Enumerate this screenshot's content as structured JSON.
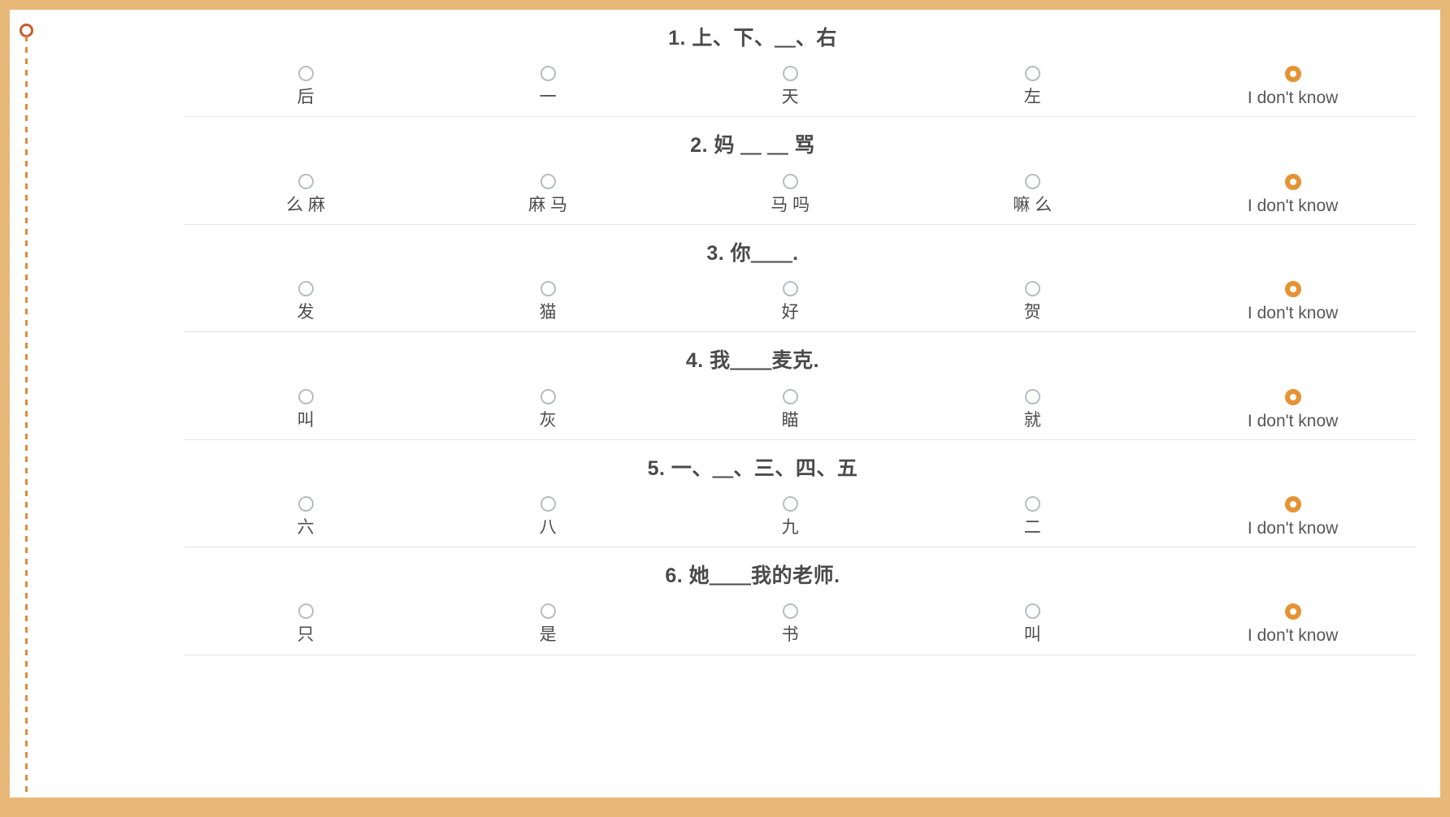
{
  "theme": {
    "frame_color": "#e8b878",
    "accent_color": "#e69334",
    "rail_dash_color": "#e08a3c",
    "rail_node_color": "#c75b28",
    "text_color": "#4a4a4a",
    "radio_border_color": "#b9bcc0",
    "separator_color": "#e3e4e6"
  },
  "rail": {
    "node_icon": "circle-node-icon",
    "line_icon": "dashed-line-icon"
  },
  "quiz": {
    "questions": [
      {
        "number": "1.",
        "title": "1. 上、下、＿、右",
        "options": [
          {
            "label": "后",
            "selected": false,
            "kind": "cjk"
          },
          {
            "label": "一",
            "selected": false,
            "kind": "cjk"
          },
          {
            "label": "天",
            "selected": false,
            "kind": "cjk"
          },
          {
            "label": "左",
            "selected": false,
            "kind": "cjk"
          },
          {
            "label": "I don't know",
            "selected": true,
            "kind": "latin"
          }
        ]
      },
      {
        "number": "2.",
        "title": "2. 妈 ＿ ＿ 骂",
        "options": [
          {
            "label": "么 麻",
            "selected": false,
            "kind": "cjk"
          },
          {
            "label": "麻 马",
            "selected": false,
            "kind": "cjk"
          },
          {
            "label": "马 吗",
            "selected": false,
            "kind": "cjk"
          },
          {
            "label": "嘛 么",
            "selected": false,
            "kind": "cjk"
          },
          {
            "label": "I don't know",
            "selected": true,
            "kind": "latin"
          }
        ]
      },
      {
        "number": "3.",
        "title": "3. 你＿＿.",
        "options": [
          {
            "label": "发",
            "selected": false,
            "kind": "cjk"
          },
          {
            "label": "猫",
            "selected": false,
            "kind": "cjk"
          },
          {
            "label": "好",
            "selected": false,
            "kind": "cjk"
          },
          {
            "label": "贺",
            "selected": false,
            "kind": "cjk"
          },
          {
            "label": "I don't know",
            "selected": true,
            "kind": "latin"
          }
        ]
      },
      {
        "number": "4.",
        "title": "4. 我＿＿麦克.",
        "options": [
          {
            "label": "叫",
            "selected": false,
            "kind": "cjk"
          },
          {
            "label": "灰",
            "selected": false,
            "kind": "cjk"
          },
          {
            "label": "瞄",
            "selected": false,
            "kind": "cjk"
          },
          {
            "label": "就",
            "selected": false,
            "kind": "cjk"
          },
          {
            "label": "I don't know",
            "selected": true,
            "kind": "latin"
          }
        ]
      },
      {
        "number": "5.",
        "title": "5. 一、＿、三、四、五",
        "options": [
          {
            "label": "六",
            "selected": false,
            "kind": "cjk"
          },
          {
            "label": "八",
            "selected": false,
            "kind": "cjk"
          },
          {
            "label": "九",
            "selected": false,
            "kind": "cjk"
          },
          {
            "label": "二",
            "selected": false,
            "kind": "cjk"
          },
          {
            "label": "I don't know",
            "selected": true,
            "kind": "latin"
          }
        ]
      },
      {
        "number": "6.",
        "title": "6. 她＿＿我的老师.",
        "options": [
          {
            "label": "只",
            "selected": false,
            "kind": "cjk"
          },
          {
            "label": "是",
            "selected": false,
            "kind": "cjk"
          },
          {
            "label": "书",
            "selected": false,
            "kind": "cjk"
          },
          {
            "label": "叫",
            "selected": false,
            "kind": "cjk"
          },
          {
            "label": "I don't know",
            "selected": true,
            "kind": "latin"
          }
        ]
      }
    ]
  }
}
